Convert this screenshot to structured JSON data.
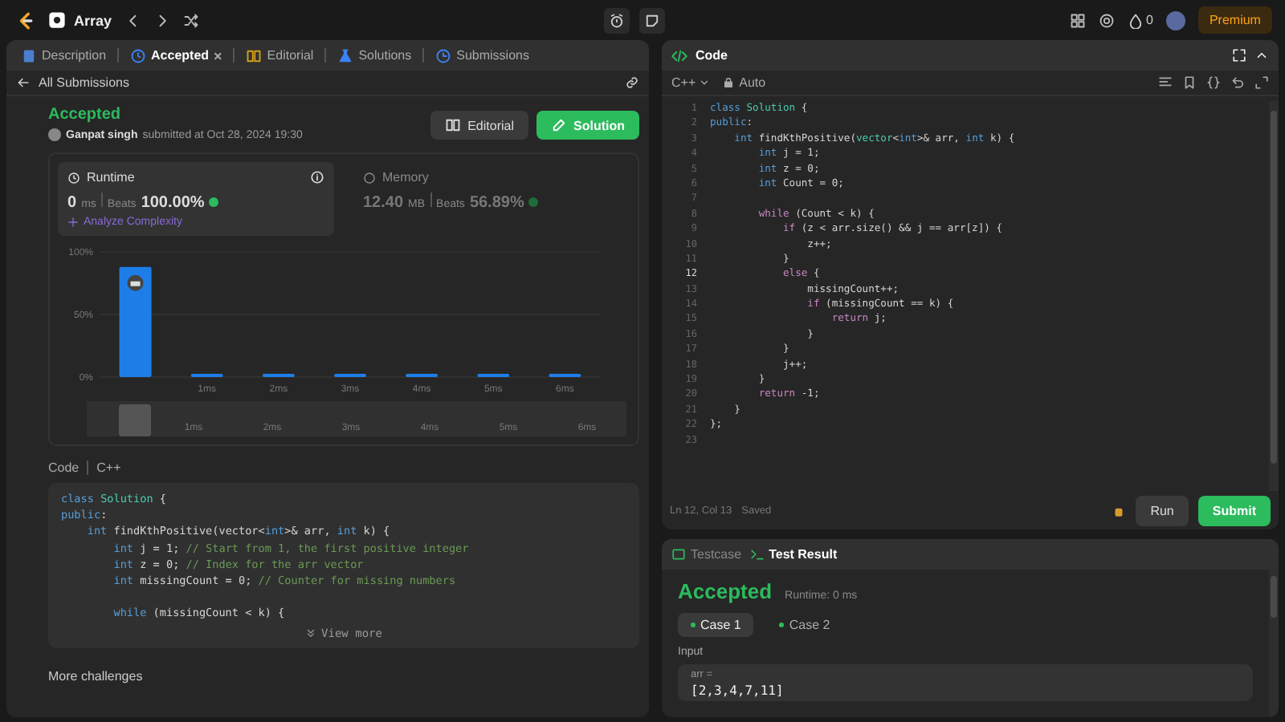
{
  "top_bar": {
    "problem_list": "Array",
    "streak": "0",
    "premium": "Premium"
  },
  "left_panel": {
    "tabs": [
      {
        "label": "Description",
        "selected": false
      },
      {
        "label": "Accepted",
        "selected": true,
        "close": "×"
      },
      {
        "label": "Editorial",
        "selected": false
      },
      {
        "label": "Solutions",
        "selected": false
      },
      {
        "label": "Submissions",
        "selected": false
      }
    ],
    "back_link": "All Submissions",
    "status": "Accepted",
    "author": "Ganpat singh",
    "submitted": "submitted at Oct 28, 2024 19:30",
    "buttons": [
      {
        "label": "Editorial",
        "kind": "secondary"
      },
      {
        "label": "Solution",
        "kind": "primary"
      }
    ],
    "stats": [
      {
        "title": "Runtime",
        "value": "0",
        "unit": "ms",
        "beats_label": "Beats",
        "beats": "100.00%",
        "selected": true,
        "link": "Analyze Complexity"
      },
      {
        "title": "Memory",
        "value": "12.40",
        "unit": "MB",
        "beats_label": "Beats",
        "beats": "56.89%",
        "selected": false
      }
    ],
    "chart_data": {
      "type": "bar",
      "categories": [
        null,
        "1ms",
        "2ms",
        "3ms",
        "4ms",
        "5ms",
        "6ms"
      ],
      "values": [
        88,
        2,
        2,
        2,
        2,
        2,
        2
      ],
      "ylim": [
        0,
        100
      ],
      "yticks": [
        {
          "value": 0,
          "label": "0%"
        },
        {
          "value": 50,
          "label": "50%"
        },
        {
          "value": 100,
          "label": "100%"
        }
      ]
    },
    "brush_labels": [
      "1ms",
      "2ms",
      "3ms",
      "4ms",
      "5ms",
      "6ms"
    ],
    "code_header": {
      "title": "Code",
      "language": "C++"
    },
    "code": [
      {
        "kind": "code",
        "tokens": [
          {
            "kind": "kw",
            "text": "class "
          },
          {
            "kind": "ty",
            "text": "Solution"
          },
          {
            "kind": "tx",
            "text": " {"
          }
        ]
      },
      {
        "kind": "code",
        "tokens": [
          {
            "kind": "kw",
            "text": "public"
          },
          {
            "kind": "tx",
            "text": ":"
          }
        ]
      },
      {
        "kind": "code",
        "tokens": [
          {
            "kind": "kw",
            "text": "    int "
          },
          {
            "kind": "tx",
            "text": "findKthPositive(vector<"
          },
          {
            "kind": "kw",
            "text": "int"
          },
          {
            "kind": "tx",
            "text": ">& arr, "
          },
          {
            "kind": "kw",
            "text": "int "
          },
          {
            "kind": "tx",
            "text": "k) {"
          }
        ]
      },
      {
        "kind": "code",
        "tokens": [
          {
            "kind": "kw",
            "text": "        int "
          },
          {
            "kind": "tx",
            "text": "j = 1; "
          },
          {
            "kind": "cm",
            "text": "// Start from 1, the first positive integer"
          }
        ]
      },
      {
        "kind": "code",
        "tokens": [
          {
            "kind": "kw",
            "text": "        int "
          },
          {
            "kind": "tx",
            "text": "z = 0; "
          },
          {
            "kind": "cm",
            "text": "// Index for the arr vector"
          }
        ]
      },
      {
        "kind": "code",
        "tokens": [
          {
            "kind": "kw",
            "text": "        int "
          },
          {
            "kind": "tx",
            "text": "missingCount = 0; "
          },
          {
            "kind": "cm",
            "text": "// Counter for missing numbers"
          }
        ]
      },
      {
        "kind": "blank"
      },
      {
        "kind": "code",
        "tokens": [
          {
            "kind": "kw",
            "text": "        while "
          },
          {
            "kind": "tx",
            "text": "(missingCount < k) {"
          }
        ]
      }
    ],
    "view_more": "View more",
    "more": "More challenges"
  },
  "editor": {
    "title": "Code",
    "language": "C++",
    "mode": "Auto",
    "lines": [
      {
        "number": "1",
        "active": false,
        "tokens": [
          {
            "kind": "kw",
            "text": "class "
          },
          {
            "kind": "ty",
            "text": "Solution"
          },
          {
            "kind": "tx",
            "text": " {"
          }
        ]
      },
      {
        "number": "2",
        "active": false,
        "tokens": [
          {
            "kind": "kw",
            "text": "public"
          },
          {
            "kind": "tx",
            "text": ":"
          }
        ]
      },
      {
        "number": "3",
        "active": false,
        "tokens": [
          {
            "kind": "kw",
            "text": "    int "
          },
          {
            "kind": "tx",
            "text": "findKthPositive("
          },
          {
            "kind": "ty",
            "text": "vector"
          },
          {
            "kind": "tx",
            "text": "<"
          },
          {
            "kind": "kw",
            "text": "int"
          },
          {
            "kind": "tx",
            "text": ">& arr, "
          },
          {
            "kind": "kw",
            "text": "int "
          },
          {
            "kind": "tx",
            "text": "k) {"
          }
        ]
      },
      {
        "number": "4",
        "active": false,
        "tokens": [
          {
            "kind": "kw",
            "text": "        int "
          },
          {
            "kind": "tx",
            "text": "j = 1;"
          }
        ]
      },
      {
        "number": "5",
        "active": false,
        "tokens": [
          {
            "kind": "kw",
            "text": "        int "
          },
          {
            "kind": "tx",
            "text": "z = 0;"
          }
        ]
      },
      {
        "number": "6",
        "active": false,
        "tokens": [
          {
            "kind": "kw",
            "text": "        int "
          },
          {
            "kind": "tx",
            "text": "Count = 0;"
          }
        ]
      },
      {
        "number": "7",
        "active": false
      },
      {
        "number": "8",
        "active": false,
        "tokens": [
          {
            "kind": "ctl",
            "text": "        while "
          },
          {
            "kind": "tx",
            "text": "(Count < k) {"
          }
        ]
      },
      {
        "number": "9",
        "active": false,
        "tokens": [
          {
            "kind": "ctl",
            "text": "            if "
          },
          {
            "kind": "tx",
            "text": "(z < arr.size() && j == arr[z]) {"
          }
        ]
      },
      {
        "number": "10",
        "active": false,
        "tokens": [
          {
            "kind": "tx",
            "text": "                z++;"
          }
        ]
      },
      {
        "number": "11",
        "active": false,
        "tokens": [
          {
            "kind": "tx",
            "text": "            }"
          }
        ]
      },
      {
        "number": "12",
        "active": true,
        "tokens": [
          {
            "kind": "ctl",
            "text": "            else "
          },
          {
            "kind": "tx",
            "text": "{"
          }
        ]
      },
      {
        "number": "13",
        "active": false,
        "tokens": [
          {
            "kind": "tx",
            "text": "                missingCount++;"
          }
        ]
      },
      {
        "number": "14",
        "active": false,
        "tokens": [
          {
            "kind": "ctl",
            "text": "                if "
          },
          {
            "kind": "tx",
            "text": "(missingCount == k) {"
          }
        ]
      },
      {
        "number": "15",
        "active": false,
        "tokens": [
          {
            "kind": "ctl",
            "text": "                    return "
          },
          {
            "kind": "tx",
            "text": "j;"
          }
        ]
      },
      {
        "number": "16",
        "active": false,
        "tokens": [
          {
            "kind": "tx",
            "text": "                }"
          }
        ]
      },
      {
        "number": "17",
        "active": false,
        "tokens": [
          {
            "kind": "tx",
            "text": "            }"
          }
        ]
      },
      {
        "number": "18",
        "active": false,
        "tokens": [
          {
            "kind": "tx",
            "text": "            j++;"
          }
        ]
      },
      {
        "number": "19",
        "active": false,
        "tokens": [
          {
            "kind": "tx",
            "text": "        }"
          }
        ]
      },
      {
        "number": "20",
        "active": false,
        "tokens": [
          {
            "kind": "ctl",
            "text": "        return "
          },
          {
            "kind": "tx",
            "text": "-1;"
          }
        ]
      },
      {
        "number": "21",
        "active": false,
        "tokens": [
          {
            "kind": "tx",
            "text": "    }"
          }
        ]
      },
      {
        "number": "22",
        "active": false,
        "tokens": [
          {
            "kind": "tx",
            "text": "};"
          }
        ]
      },
      {
        "number": "23",
        "active": false
      }
    ],
    "cursor": "Ln 12, Col 13",
    "save_state": "Saved",
    "run": "Run",
    "submit": "Submit"
  },
  "result_panel": {
    "tabs": [
      {
        "label": "Testcase",
        "selected": false
      },
      {
        "label": "Test Result",
        "selected": true
      }
    ],
    "status": "Accepted",
    "runtime": "Runtime: 0 ms",
    "cases": [
      {
        "label": "Case 1",
        "selected": true
      },
      {
        "label": "Case 2",
        "selected": false
      }
    ],
    "input_label": "Input",
    "param": "arr =",
    "value": "[2,3,4,7,11]"
  }
}
